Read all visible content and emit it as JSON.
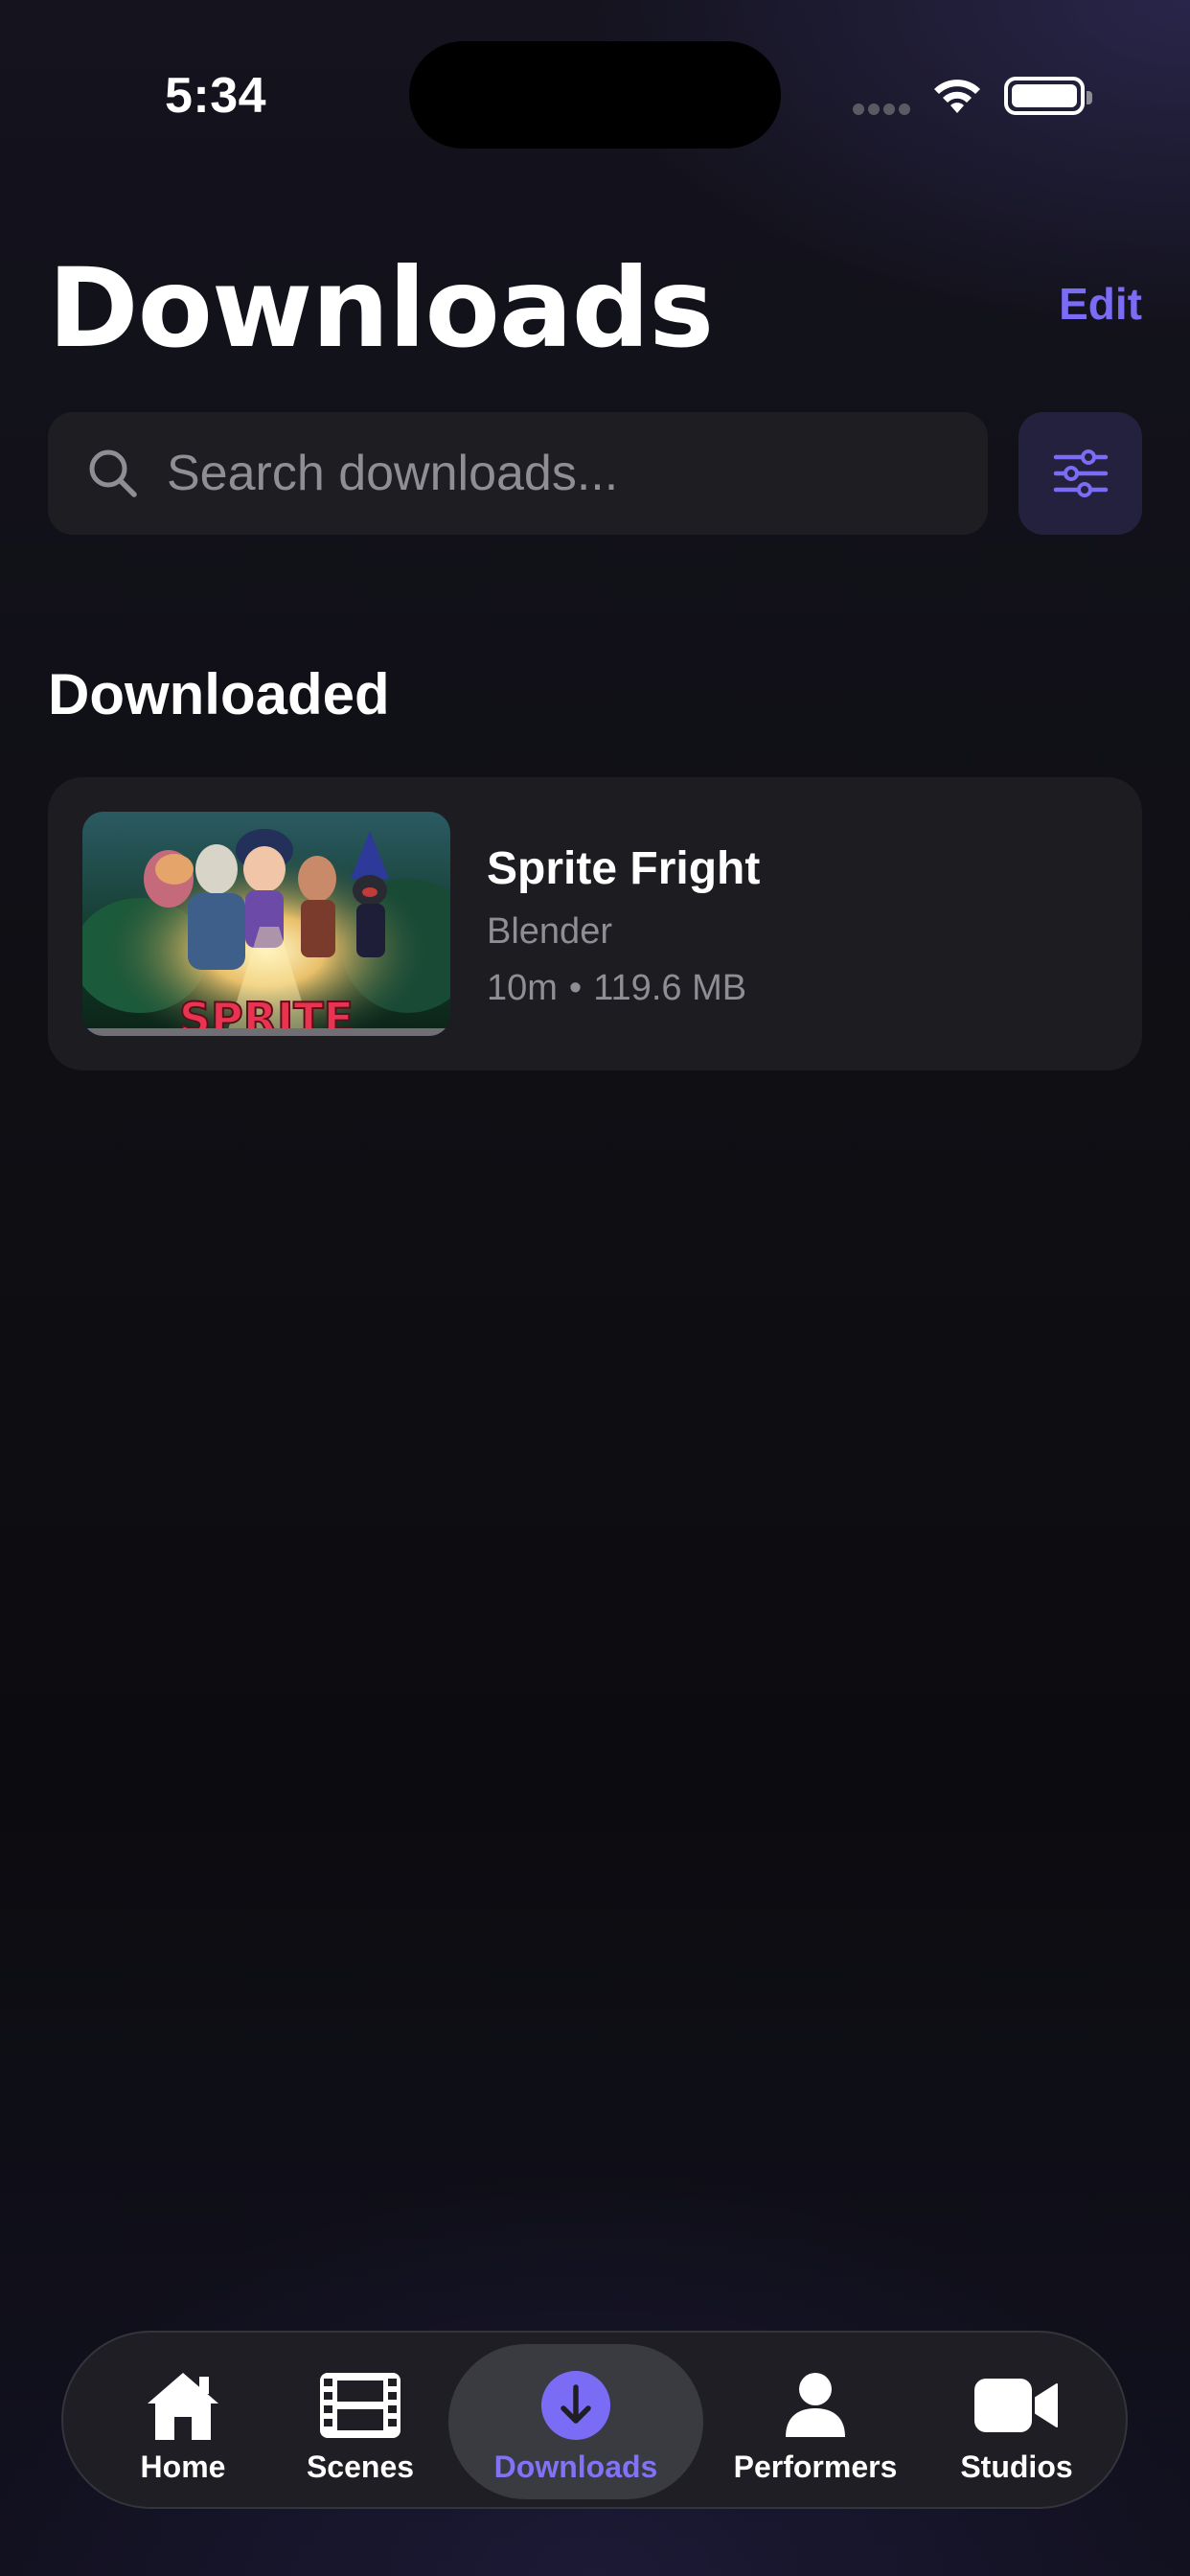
{
  "status_bar": {
    "time": "5:34"
  },
  "header": {
    "title": "Downloads",
    "edit_label": "Edit"
  },
  "search": {
    "placeholder": "Search downloads...",
    "value": ""
  },
  "section": {
    "title": "Downloaded"
  },
  "downloads": [
    {
      "title": "Sprite Fright",
      "studio": "Blender",
      "duration": "10m",
      "separator": "•",
      "size": "119.6 MB",
      "watch_progress": 0.02
    }
  ],
  "tab_bar": {
    "tabs": [
      {
        "label": "Home",
        "icon": "house-icon"
      },
      {
        "label": "Scenes",
        "icon": "film-icon"
      },
      {
        "label": "Downloads",
        "icon": "download-circle-icon",
        "active": true
      },
      {
        "label": "Performers",
        "icon": "person-icon"
      },
      {
        "label": "Studios",
        "icon": "video-camera-icon"
      }
    ]
  },
  "colors": {
    "accent": "#7b6cf6",
    "background": "#0f0f14",
    "card": "#1c1c21",
    "secondary_text": "#8e8e94"
  }
}
